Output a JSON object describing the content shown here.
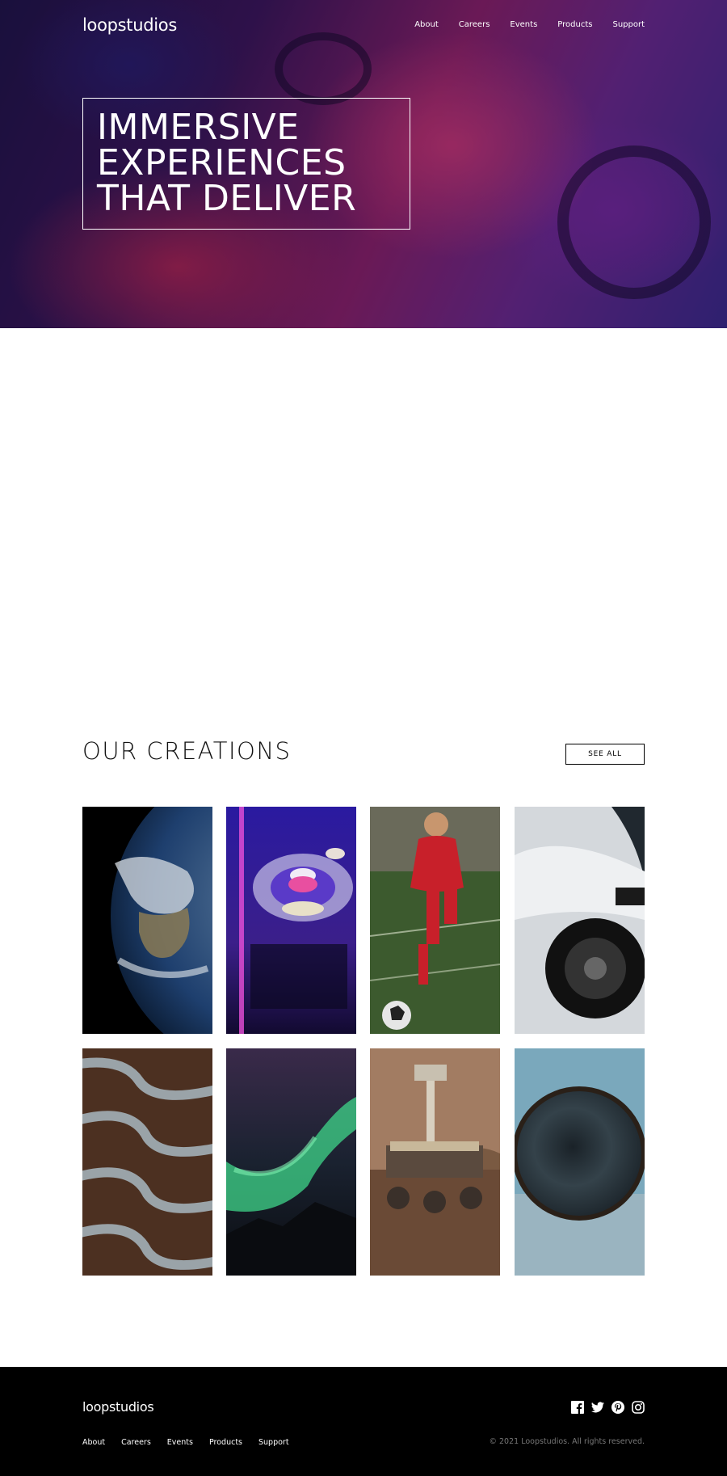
{
  "brand": {
    "logo": "loopstudios"
  },
  "nav": {
    "items": [
      "About",
      "Careers",
      "Events",
      "Products",
      "Support"
    ]
  },
  "hero": {
    "headline_lines": [
      "IMMERSIVE",
      "EXPERIENCES",
      "THAT DELIVER"
    ]
  },
  "creations": {
    "title": "OUR CREATIONS",
    "see_all_label": "SEE ALL",
    "items": [
      {
        "name": "earth-image"
      },
      {
        "name": "arcade-image"
      },
      {
        "name": "soccer-image"
      },
      {
        "name": "race-car-image"
      },
      {
        "name": "curving-road-image"
      },
      {
        "name": "aurora-image"
      },
      {
        "name": "mars-rover-image"
      },
      {
        "name": "fisheye-image"
      }
    ]
  },
  "footer": {
    "logo": "loopstudios",
    "nav": [
      "About",
      "Careers",
      "Events",
      "Products",
      "Support"
    ],
    "social": [
      "facebook-icon",
      "twitter-icon",
      "pinterest-icon",
      "instagram-icon"
    ],
    "copyright": "© 2021 Loopstudios. All rights reserved."
  },
  "colors": {
    "footer_bg": "#000000",
    "copyright_text": "#777777",
    "hero_accent": "#8a2168"
  }
}
